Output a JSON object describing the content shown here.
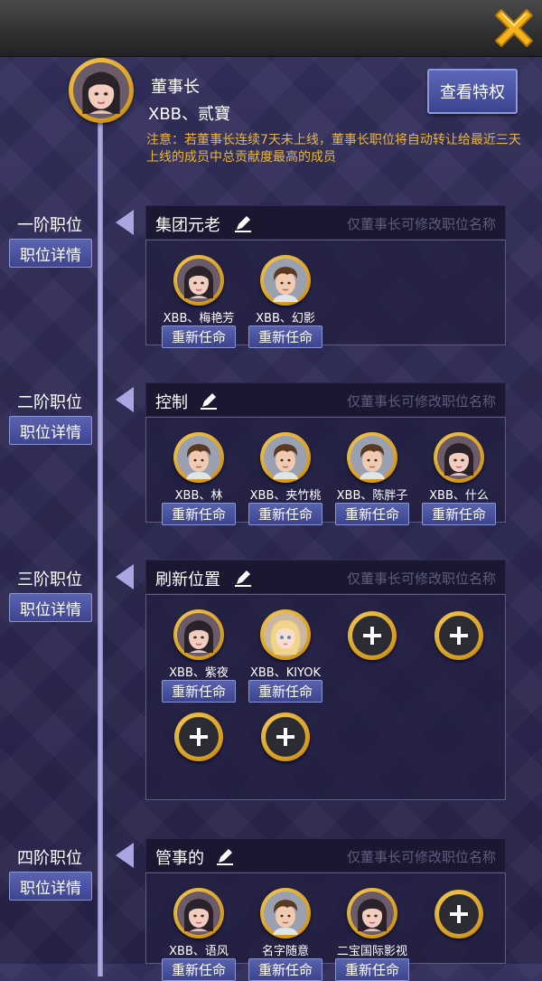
{
  "leader": {
    "title": "董事长",
    "name": "XBB、贰寶",
    "privilege_button": "查看特权",
    "notice": "注意：若董事长连续7天未上线，董事长职位将自动转让给最近三天上线的成员中总贡献度最高的成员"
  },
  "tiers": [
    {
      "label": "一阶职位",
      "detail_button": "职位详情",
      "name": "集团元老",
      "hint": "仅董事长可修改职位名称",
      "members": [
        {
          "name": "XBB、梅艳芳",
          "button": "重新任命",
          "avatar": "female-avatar"
        },
        {
          "name": "XBB、幻影",
          "button": "重新任命",
          "avatar": "male-avatar"
        }
      ]
    },
    {
      "label": "二阶职位",
      "detail_button": "职位详情",
      "name": "控制",
      "hint": "仅董事长可修改职位名称",
      "members": [
        {
          "name": "XBB、林",
          "button": "重新任命",
          "avatar": "male-avatar"
        },
        {
          "name": "XBB、夹竹桃",
          "button": "重新任命",
          "avatar": "male-avatar"
        },
        {
          "name": "XBB、陈胖子",
          "button": "重新任命",
          "avatar": "male-avatar"
        },
        {
          "name": "XBB、什么",
          "button": "重新任命",
          "avatar": "female-avatar"
        }
      ]
    },
    {
      "label": "三阶职位",
      "detail_button": "职位详情",
      "name": "刷新位置",
      "hint": "仅董事长可修改职位名称",
      "members": [
        {
          "name": "XBB、紫夜",
          "button": "重新任命",
          "avatar": "female-avatar"
        },
        {
          "name": "XBB、KIYOK",
          "button": "重新任命",
          "avatar": "blonde-avatar"
        }
      ]
    },
    {
      "label": "四阶职位",
      "detail_button": "职位详情",
      "name": "管事的",
      "hint": "仅董事长可修改职位名称",
      "members": [
        {
          "name": "XBB、语风",
          "button": "重新任命",
          "avatar": "female-avatar"
        },
        {
          "name": "名字随意",
          "button": "重新任命",
          "avatar": "male-avatar"
        },
        {
          "name": "二宝国际影视",
          "button": "重新任命",
          "avatar": "female-avatar"
        }
      ]
    }
  ],
  "colors": {
    "accent_gold": "#e8b640",
    "button_blue": "#4a52a0",
    "timeline": "#aaa6e2"
  },
  "icons": {
    "close": "close-x-icon",
    "edit": "pen-icon",
    "add": "plus-icon"
  }
}
